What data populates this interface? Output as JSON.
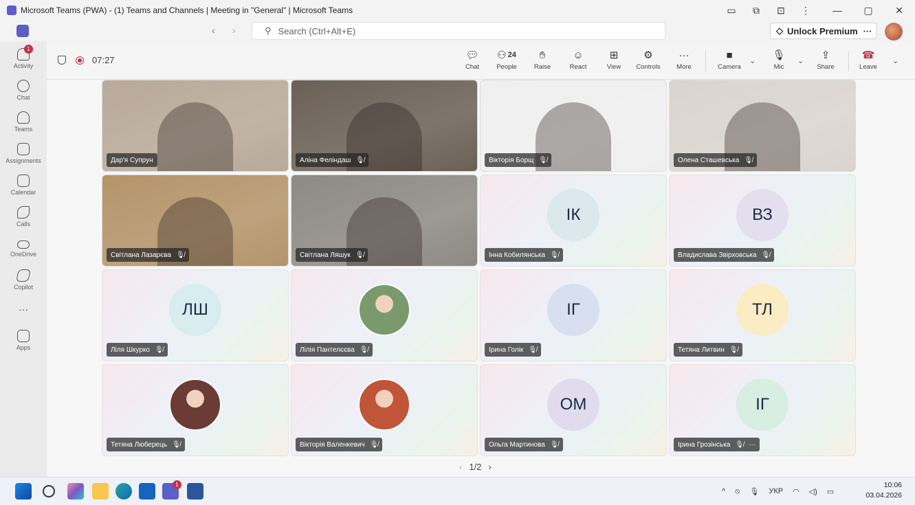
{
  "window": {
    "title": "Microsoft Teams (PWA) - (1) Teams and Channels | Meeting in \"General\" | Microsoft Teams"
  },
  "search": {
    "placeholder": "Search (Ctrl+Alt+E)"
  },
  "premium": {
    "label": "Unlock Premium",
    "more": "···"
  },
  "rail": [
    {
      "label": "Activity",
      "icon": "bell-icon",
      "badge": "1"
    },
    {
      "label": "Chat",
      "icon": "chat-icon"
    },
    {
      "label": "Teams",
      "icon": "teams-icon"
    },
    {
      "label": "Assignments",
      "icon": "assignments-icon"
    },
    {
      "label": "Calendar",
      "icon": "calendar-icon"
    },
    {
      "label": "Calls",
      "icon": "phone-icon"
    },
    {
      "label": "OneDrive",
      "icon": "cloud-icon"
    },
    {
      "label": "Copilot",
      "icon": "copilot-icon"
    },
    {
      "label": "···",
      "icon": "more-icon"
    },
    {
      "label": "Apps",
      "icon": "plus-icon"
    }
  ],
  "meeting": {
    "timer": "07:27",
    "controls": {
      "chat": "Chat",
      "people": "People",
      "people_count": "24",
      "raise": "Raise",
      "react": "React",
      "view": "View",
      "controls": "Controls",
      "more": "More",
      "camera": "Camera",
      "mic": "Mic",
      "share": "Share",
      "leave": "Leave"
    },
    "pager": {
      "prev": "‹",
      "page": "1/2",
      "next": "›"
    }
  },
  "participants": [
    {
      "name": "Дар'я Супрун",
      "type": "video",
      "muted": false,
      "bg": "#b8a999"
    },
    {
      "name": "Аліна Феліндаш",
      "type": "video",
      "muted": true,
      "bg": "#6a6056"
    },
    {
      "name": "Вікторія Борщ",
      "type": "video",
      "muted": true,
      "bg": "#efefef"
    },
    {
      "name": "Олена Сташевська",
      "type": "video",
      "muted": true,
      "bg": "#d9d4cf"
    },
    {
      "name": "Світлана Лазарєва",
      "type": "video",
      "muted": true,
      "bg": "#b4946a"
    },
    {
      "name": "Світлана Ляшук",
      "type": "video",
      "muted": true,
      "bg": "#8d8984"
    },
    {
      "name": "Інна Кобилянська",
      "type": "initials",
      "initials": "ІК",
      "color": "#dbe8ee",
      "muted": true
    },
    {
      "name": "Владислава Звірховська",
      "type": "initials",
      "initials": "ВЗ",
      "color": "#e4dfee",
      "muted": true
    },
    {
      "name": "Ліля Шкурко",
      "type": "initials",
      "initials": "ЛШ",
      "color": "#d7edf0",
      "muted": true
    },
    {
      "name": "Лілія Пантелєєва",
      "type": "photo",
      "color": "#7a9a6e",
      "muted": true
    },
    {
      "name": "Ірина Голік",
      "type": "initials",
      "initials": "ІГ",
      "color": "#d8e0f0",
      "muted": true
    },
    {
      "name": "Тетяна Литвин",
      "type": "initials",
      "initials": "ТЛ",
      "color": "#fbecc4",
      "muted": true
    },
    {
      "name": "Тетяна Люберець",
      "type": "photo",
      "color": "#6b3c36",
      "muted": true
    },
    {
      "name": "Вікторія Валенкевич",
      "type": "photo",
      "color": "#c0553a",
      "muted": true
    },
    {
      "name": "Ольга Мартинова",
      "type": "initials",
      "initials": "ОМ",
      "color": "#e0dcee",
      "muted": true
    },
    {
      "name": "Ірина Грозінська",
      "type": "initials",
      "initials": "ІГ",
      "color": "#d9eee2",
      "muted": true,
      "more": "···"
    }
  ],
  "taskbar": {
    "lang": "УКР",
    "time": "10:06",
    "date": "03.04.2026",
    "teams_badge": "1"
  }
}
